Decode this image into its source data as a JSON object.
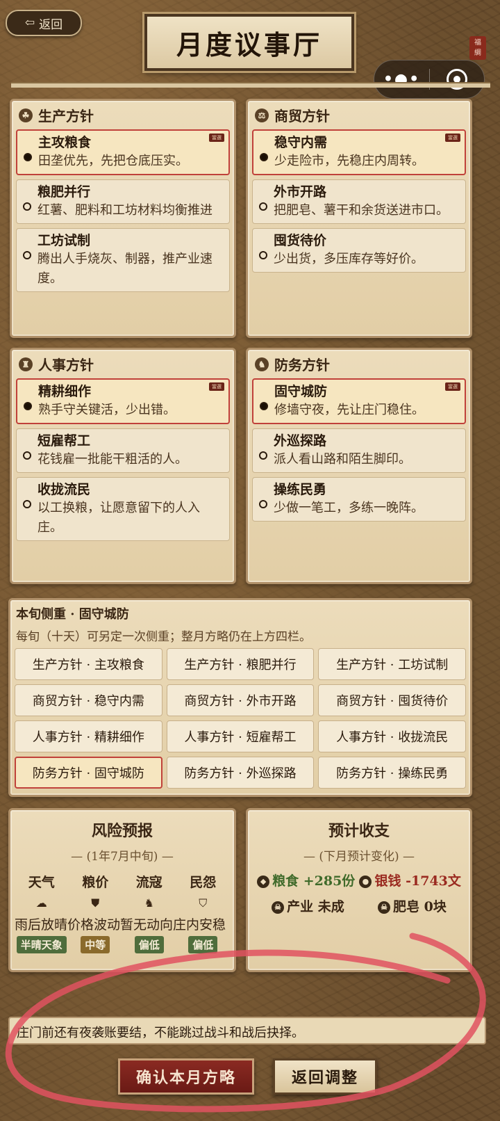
{
  "header": {
    "back_label": "返回",
    "title": "月度议事厅",
    "seal_text": "福綢"
  },
  "panels": [
    {
      "title": "生产方针",
      "icon": "wheat-icon",
      "options": [
        {
          "name": "主攻粮食",
          "desc": "田垄优先，先把仓底压实。",
          "selected": true
        },
        {
          "name": "粮肥并行",
          "desc": "红薯、肥料和工坊材料均衡推进",
          "selected": false
        },
        {
          "name": "工坊试制",
          "desc": "腾出人手烧灰、制器，推产业速度。",
          "selected": false
        }
      ]
    },
    {
      "title": "商贸方针",
      "icon": "scale-icon",
      "options": [
        {
          "name": "稳守内需",
          "desc": "少走险市，先稳庄内周转。",
          "selected": true
        },
        {
          "name": "外市开路",
          "desc": "把肥皂、薯干和余货送进市口。",
          "selected": false
        },
        {
          "name": "囤货待价",
          "desc": "少出货，多压库存等好价。",
          "selected": false
        }
      ]
    },
    {
      "title": "人事方针",
      "icon": "people-icon",
      "options": [
        {
          "name": "精耕细作",
          "desc": "熟手守关键活，少出错。",
          "selected": true
        },
        {
          "name": "短雇帮工",
          "desc": "花钱雇一批能干粗活的人。",
          "selected": false
        },
        {
          "name": "收拢流民",
          "desc": "以工换粮，让愿意留下的人入庄。",
          "selected": false
        }
      ]
    },
    {
      "title": "防务方针",
      "icon": "guard-icon",
      "options": [
        {
          "name": "固守城防",
          "desc": "修墙守夜，先让庄门稳住。",
          "selected": true
        },
        {
          "name": "外巡探路",
          "desc": "派人看山路和陌生脚印。",
          "selected": false
        },
        {
          "name": "操练民勇",
          "desc": "少做一笔工，多练一晚阵。",
          "selected": false
        }
      ]
    }
  ],
  "selected_tag": "當選",
  "focus": {
    "title": "本旬侧重 · 固守城防",
    "note": "每旬（十天）可另定一次侧重；整月方略仍在上方四栏。",
    "buttons": [
      {
        "label": "生产方针 · 主攻粮食",
        "selected": false
      },
      {
        "label": "生产方针 · 粮肥并行",
        "selected": false
      },
      {
        "label": "生产方针 · 工坊试制",
        "selected": false
      },
      {
        "label": "商贸方针 · 稳守内需",
        "selected": false
      },
      {
        "label": "商贸方针 · 外市开路",
        "selected": false
      },
      {
        "label": "商贸方针 · 囤货待价",
        "selected": false
      },
      {
        "label": "人事方针 · 精耕细作",
        "selected": false
      },
      {
        "label": "人事方针 · 短雇帮工",
        "selected": false
      },
      {
        "label": "人事方针 · 收拢流民",
        "selected": false
      },
      {
        "label": "防务方针 · 固守城防",
        "selected": true
      },
      {
        "label": "防务方针 · 外巡探路",
        "selected": false
      },
      {
        "label": "防务方针 · 操练民勇",
        "selected": false
      }
    ]
  },
  "risk": {
    "title": "风险预报",
    "subtitle": "— (1年7月中旬) —",
    "columns": [
      {
        "label": "天气",
        "icon": "cloud-icon",
        "badge": "半晴天象"
      },
      {
        "label": "粮价",
        "icon": "grain-bag-icon",
        "badge": "中等"
      },
      {
        "label": "流寇",
        "icon": "horse-rider-icon",
        "badge": "偏低"
      },
      {
        "label": "民怨",
        "icon": "shield-face-icon",
        "badge": "偏低"
      }
    ],
    "summary": "雨后放晴价格波动暂无动向庄内安稳"
  },
  "forecast": {
    "title": "预计收支",
    "subtitle": "— (下月预计变化) —",
    "food_label": "粮食",
    "food_value": "+285份",
    "silver_label": "银钱",
    "silver_value": "-1743文",
    "industry_label": "产业",
    "industry_value": "未成",
    "soap_label": "肥皂",
    "soap_value": "0块",
    "colors": {
      "positive": "#3f6a2a",
      "negative": "#9a2a20"
    }
  },
  "notice": "庄门前还有夜袭账要结，不能跳过战斗和战后抉择。",
  "actions": {
    "confirm_label": "确认本月方略",
    "back_label": "返回调整"
  }
}
